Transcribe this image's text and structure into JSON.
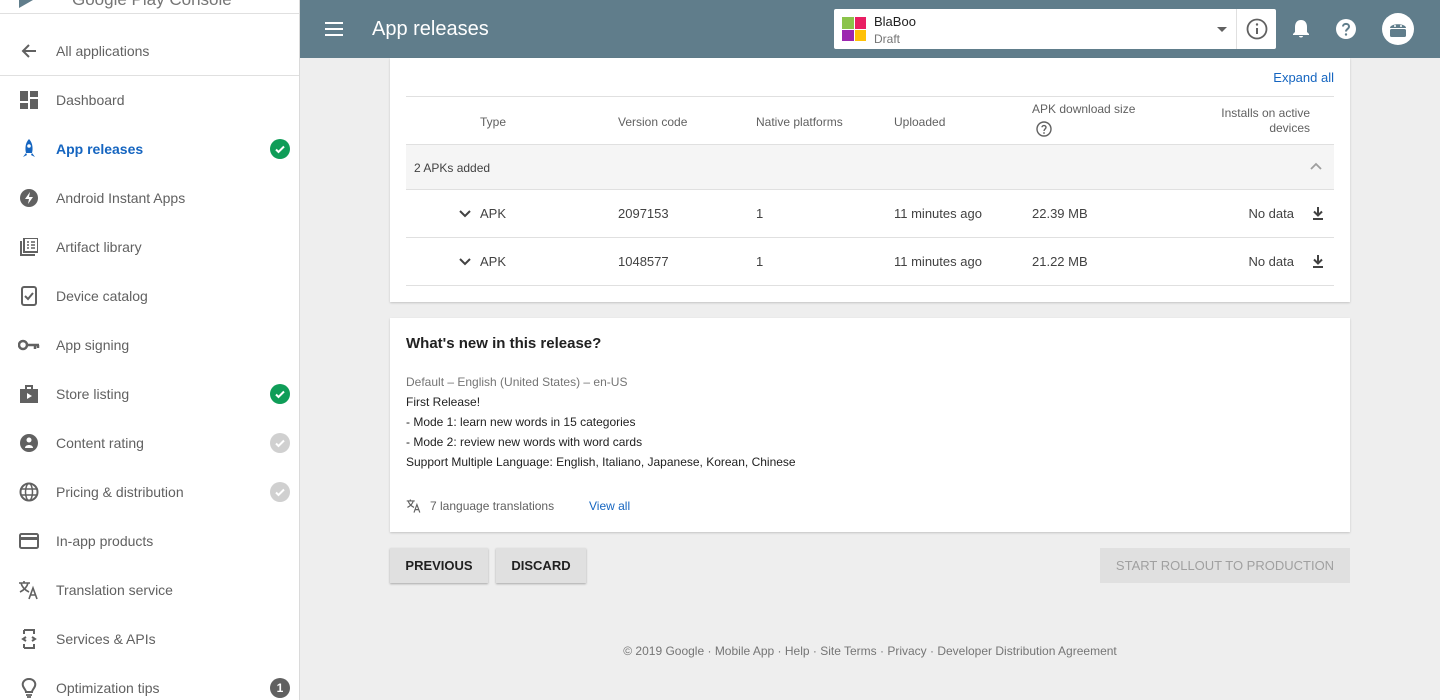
{
  "brand": {
    "name": "Google Play Console"
  },
  "sidebar": {
    "back_label": "All applications",
    "items": [
      {
        "label": "Dashboard",
        "icon": "dashboard-icon",
        "status": ""
      },
      {
        "label": "App releases",
        "icon": "rocket-icon",
        "status": "complete"
      },
      {
        "label": "Android Instant Apps",
        "icon": "bolt-icon",
        "status": ""
      },
      {
        "label": "Artifact library",
        "icon": "library-icon",
        "status": ""
      },
      {
        "label": "Device catalog",
        "icon": "device-icon",
        "status": ""
      },
      {
        "label": "App signing",
        "icon": "key-icon",
        "status": ""
      },
      {
        "label": "Store listing",
        "icon": "store-icon",
        "status": "complete"
      },
      {
        "label": "Content rating",
        "icon": "rating-icon",
        "status": "pending"
      },
      {
        "label": "Pricing & distribution",
        "icon": "globe-icon",
        "status": "pending"
      },
      {
        "label": "In-app products",
        "icon": "card-icon",
        "status": ""
      },
      {
        "label": "Translation service",
        "icon": "translate-icon",
        "status": ""
      },
      {
        "label": "Services & APIs",
        "icon": "api-icon",
        "status": ""
      },
      {
        "label": "Optimization tips",
        "icon": "lightbulb-icon",
        "status": "1"
      }
    ]
  },
  "topbar": {
    "title": "App releases",
    "app_name": "BlaBoo",
    "app_status": "Draft"
  },
  "releases": {
    "expand_all": "Expand all",
    "columns": {
      "type": "Type",
      "version": "Version code",
      "native": "Native platforms",
      "uploaded": "Uploaded",
      "size": "APK download size",
      "installs": "Installs on active devices"
    },
    "group_label": "2 APKs added",
    "rows": [
      {
        "type": "APK",
        "version": "2097153",
        "native": "1",
        "uploaded": "11 minutes ago",
        "size": "22.39 MB",
        "installs": "No data"
      },
      {
        "type": "APK",
        "version": "1048577",
        "native": "1",
        "uploaded": "11 minutes ago",
        "size": "21.22 MB",
        "installs": "No data"
      }
    ]
  },
  "whatsnew": {
    "title": "What's new in this release?",
    "locale": "Default – English (United States) – en-US",
    "lines": [
      "First Release!",
      "- Mode 1: learn new words in 15 categories",
      "- Mode 2: review new words with word cards",
      "Support Multiple Language: English, Italiano, Japanese, Korean, Chinese"
    ],
    "translations": "7 language translations",
    "view_all": "View all"
  },
  "actions": {
    "previous": "PREVIOUS",
    "discard": "DISCARD",
    "start": "START ROLLOUT TO PRODUCTION"
  },
  "footer": "© 2019 Google · Mobile App · Help · Site Terms · Privacy · Developer Distribution Agreement",
  "colors": {
    "topbar": "#607d8b",
    "accent": "#1565c0",
    "success": "#0f9d58"
  }
}
